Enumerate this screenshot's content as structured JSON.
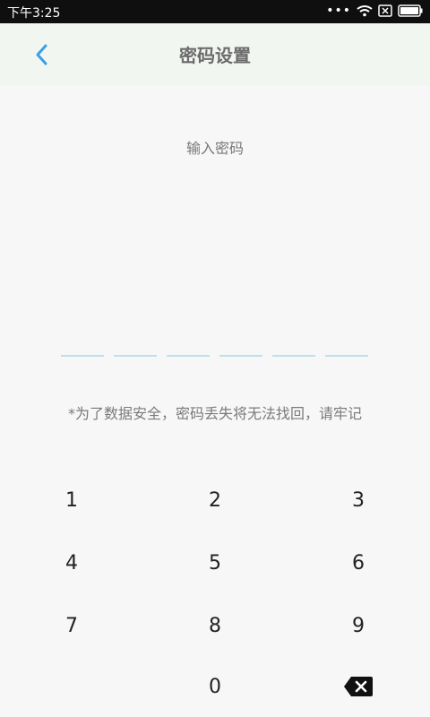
{
  "status_bar": {
    "time": "下午3:25",
    "dots": "•••"
  },
  "header": {
    "title": "密码设置"
  },
  "prompt": "输入密码",
  "notice": "*为了数据安全，密码丢失将无法找回，请牢记",
  "keypad": {
    "keys": [
      {
        "label": "1"
      },
      {
        "label": "2"
      },
      {
        "label": "3"
      },
      {
        "label": "4"
      },
      {
        "label": "5"
      },
      {
        "label": "6"
      },
      {
        "label": "7"
      },
      {
        "label": "8"
      },
      {
        "label": "9"
      },
      {
        "label": "0"
      }
    ],
    "delete_icon": "backspace-icon"
  },
  "colors": {
    "accent": "#3aa0e6",
    "pin_line": "#bfe0ea",
    "header_bg": "#f1f6f1",
    "page_bg": "#f7f7f7"
  }
}
